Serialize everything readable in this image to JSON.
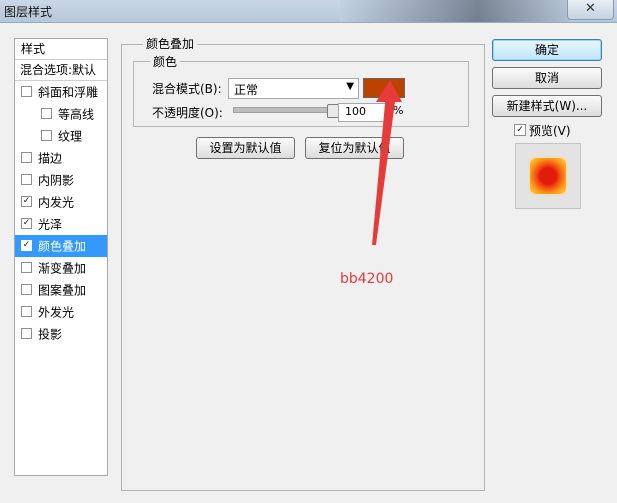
{
  "window": {
    "title": "图层样式",
    "close_glyph": "✕"
  },
  "styles_panel": {
    "header": "样式",
    "blend_options": "混合选项:默认",
    "items": [
      {
        "label": "斜面和浮雕",
        "checked": false,
        "sub": false,
        "selected": false
      },
      {
        "label": "等高线",
        "checked": false,
        "sub": true,
        "selected": false
      },
      {
        "label": "纹理",
        "checked": false,
        "sub": true,
        "selected": false
      },
      {
        "label": "描边",
        "checked": false,
        "sub": false,
        "selected": false
      },
      {
        "label": "内阴影",
        "checked": false,
        "sub": false,
        "selected": false
      },
      {
        "label": "内发光",
        "checked": true,
        "sub": false,
        "selected": false
      },
      {
        "label": "光泽",
        "checked": true,
        "sub": false,
        "selected": false
      },
      {
        "label": "颜色叠加",
        "checked": true,
        "sub": false,
        "selected": true
      },
      {
        "label": "渐变叠加",
        "checked": false,
        "sub": false,
        "selected": false
      },
      {
        "label": "图案叠加",
        "checked": false,
        "sub": false,
        "selected": false
      },
      {
        "label": "外发光",
        "checked": false,
        "sub": false,
        "selected": false
      },
      {
        "label": "投影",
        "checked": false,
        "sub": false,
        "selected": false
      }
    ]
  },
  "color_overlay": {
    "group_title": "颜色叠加",
    "inner_title": "颜色",
    "blend_mode_label": "混合模式(B):",
    "blend_mode_value": "正常",
    "overlay_color": "#bb4200",
    "opacity_label": "不透明度(O):",
    "opacity_value": "100",
    "opacity_fraction": 1.0,
    "opacity_unit": "%",
    "set_default": "设置为默认值",
    "reset_default": "复位为默认值"
  },
  "right_panel": {
    "ok": "确定",
    "cancel": "取消",
    "new_style": "新建样式(W)...",
    "preview_label": "预览(V)",
    "preview_checked": true
  },
  "annotation": {
    "text": "bb4200",
    "color": "#e53b3b"
  }
}
